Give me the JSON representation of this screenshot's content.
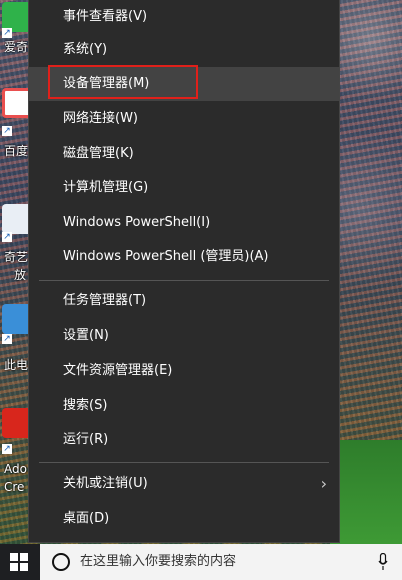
{
  "menu": {
    "items": [
      {
        "label": "事件查看器(V)"
      },
      {
        "label": "系统(Y)"
      },
      {
        "label": "设备管理器(M)"
      },
      {
        "label": "网络连接(W)"
      },
      {
        "label": "磁盘管理(K)"
      },
      {
        "label": "计算机管理(G)"
      },
      {
        "label": "Windows PowerShell(I)"
      },
      {
        "label": "Windows PowerShell (管理员)(A)"
      },
      {
        "label": "任务管理器(T)"
      },
      {
        "label": "设置(N)"
      },
      {
        "label": "文件资源管理器(E)"
      },
      {
        "label": "搜索(S)"
      },
      {
        "label": "运行(R)"
      },
      {
        "label": "关机或注销(U)"
      },
      {
        "label": "桌面(D)"
      }
    ],
    "submenu_arrow": "›",
    "highlighted_item": "设备管理器(M)",
    "highlight_color": "#e0201a"
  },
  "desktop_icons": [
    {
      "label": "爱奇",
      "color": "#2fb24a"
    },
    {
      "label": "百度",
      "color": "#e94f4f"
    },
    {
      "label": "奇艺",
      "label2": "放",
      "color": "#ffffff"
    },
    {
      "label": "此电",
      "color": "#3a8fd8"
    },
    {
      "label": "Ado",
      "label2": "Cre",
      "color": "#d8261c"
    }
  ],
  "taskbar": {
    "search_placeholder": "在这里输入你要搜索的内容",
    "start_icon": "windows-logo-icon",
    "search_icon": "search-circle-icon",
    "mic_icon": "microphone-icon"
  }
}
